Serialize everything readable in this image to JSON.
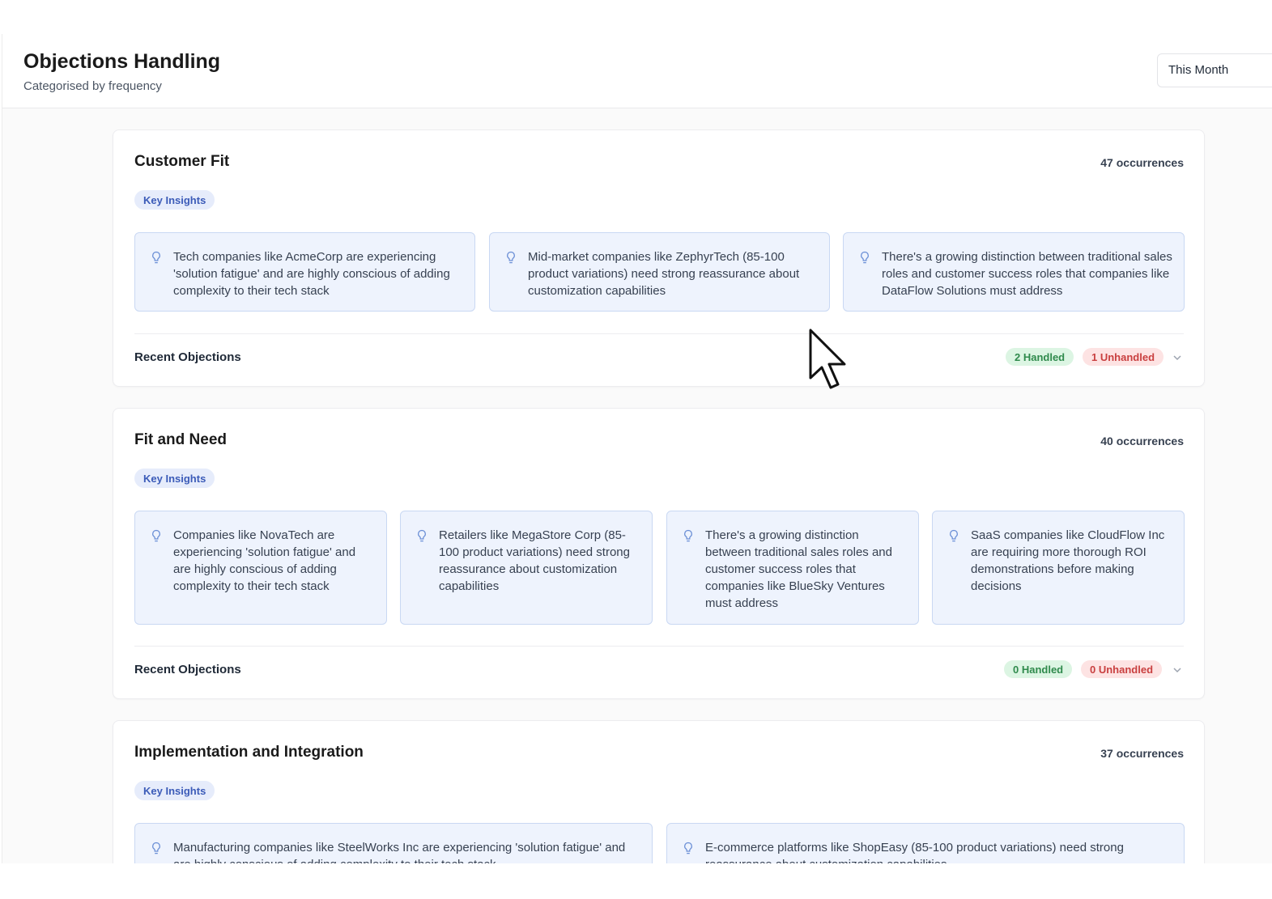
{
  "header": {
    "title": "Objections Handling",
    "subtitle": "Categorised by frequency",
    "period": "This Month"
  },
  "sections": [
    {
      "title": "Customer Fit",
      "occurrences": "47 occurrences",
      "badge": "Key Insights",
      "insights": [
        "Tech companies like AcmeCorp are experiencing 'solution fatigue' and are highly conscious of adding complexity to their tech stack",
        "Mid-market companies like ZephyrTech (85-100 product variations) need strong reassurance about customization capabilities",
        "There's a growing distinction between traditional sales roles and customer success roles that companies like DataFlow Solutions must address"
      ],
      "recent_label": "Recent Objections",
      "handled": "2 Handled",
      "unhandled": "1 Unhandled"
    },
    {
      "title": "Fit and Need",
      "occurrences": "40 occurrences",
      "badge": "Key Insights",
      "insights": [
        "Companies like NovaTech are experiencing 'solution fatigue' and are highly conscious of adding complexity to their tech stack",
        "Retailers like MegaStore Corp (85-100 product variations) need strong reassurance about customization capabilities",
        "There's a growing distinction between traditional sales roles and customer success roles that companies like BlueSky Ventures must address",
        "SaaS companies like CloudFlow Inc are requiring more thorough ROI demonstrations before making decisions"
      ],
      "recent_label": "Recent Objections",
      "handled": "0 Handled",
      "unhandled": "0 Unhandled"
    },
    {
      "title": "Implementation and Integration",
      "occurrences": "37 occurrences",
      "badge": "Key Insights",
      "insights": [
        "Manufacturing companies like SteelWorks Inc are experiencing 'solution fatigue' and are highly conscious of adding complexity to their tech stack",
        "E-commerce platforms like ShopEasy (85-100 product variations) need strong reassurance about customization capabilities"
      ]
    }
  ],
  "icons": {
    "insight": "lightbulb-icon",
    "expand": "chevron-down-icon",
    "pointer": "mouse-cursor-icon"
  },
  "colors": {
    "badge_bg": "#e6ecfb",
    "insight_bg": "#eef3fd",
    "handled": "#2f8a4c",
    "unhandled": "#c94040"
  }
}
